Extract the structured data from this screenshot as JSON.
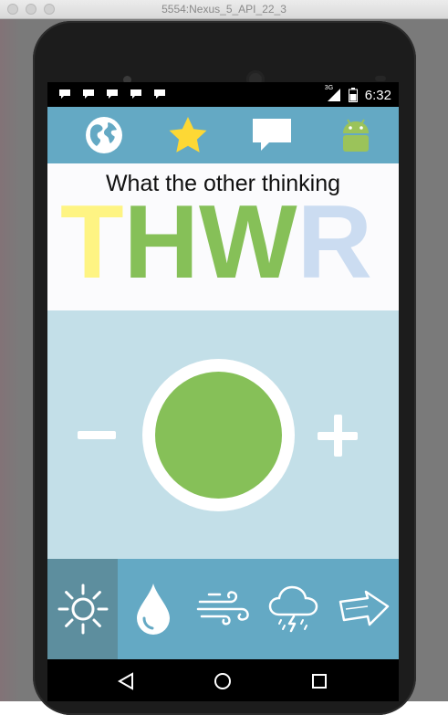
{
  "window": {
    "title": "5554:Nexus_5_API_22_3"
  },
  "status_bar": {
    "time": "6:32",
    "network": "3G"
  },
  "app_bar": {
    "icons": [
      "globe-icon",
      "star-icon",
      "chat-bubble-icon",
      "android-icon"
    ]
  },
  "header": {
    "subtitle": "What the other thinking",
    "brand_letters": [
      {
        "char": "T",
        "color": "#fef483"
      },
      {
        "char": "H",
        "color": "#86c058"
      },
      {
        "char": "W",
        "color": "#86c058"
      },
      {
        "char": "R",
        "color": "#cbdcf1"
      }
    ]
  },
  "main": {
    "indicator_color": "#86c058",
    "controls": [
      "minus-icon",
      "plus-icon"
    ]
  },
  "weather_tabs": [
    {
      "icon": "sun-icon",
      "active": true
    },
    {
      "icon": "raindrop-icon",
      "active": false
    },
    {
      "icon": "wind-icon",
      "active": false
    },
    {
      "icon": "storm-cloud-icon",
      "active": false
    },
    {
      "icon": "arrow-right-icon",
      "active": false
    }
  ],
  "colors": {
    "app_bar": "#64a9c4",
    "main_bg": "#c3dfe8",
    "active_tab": "#5d8e9e",
    "star": "#fdd835",
    "android": "#9bc35a"
  }
}
